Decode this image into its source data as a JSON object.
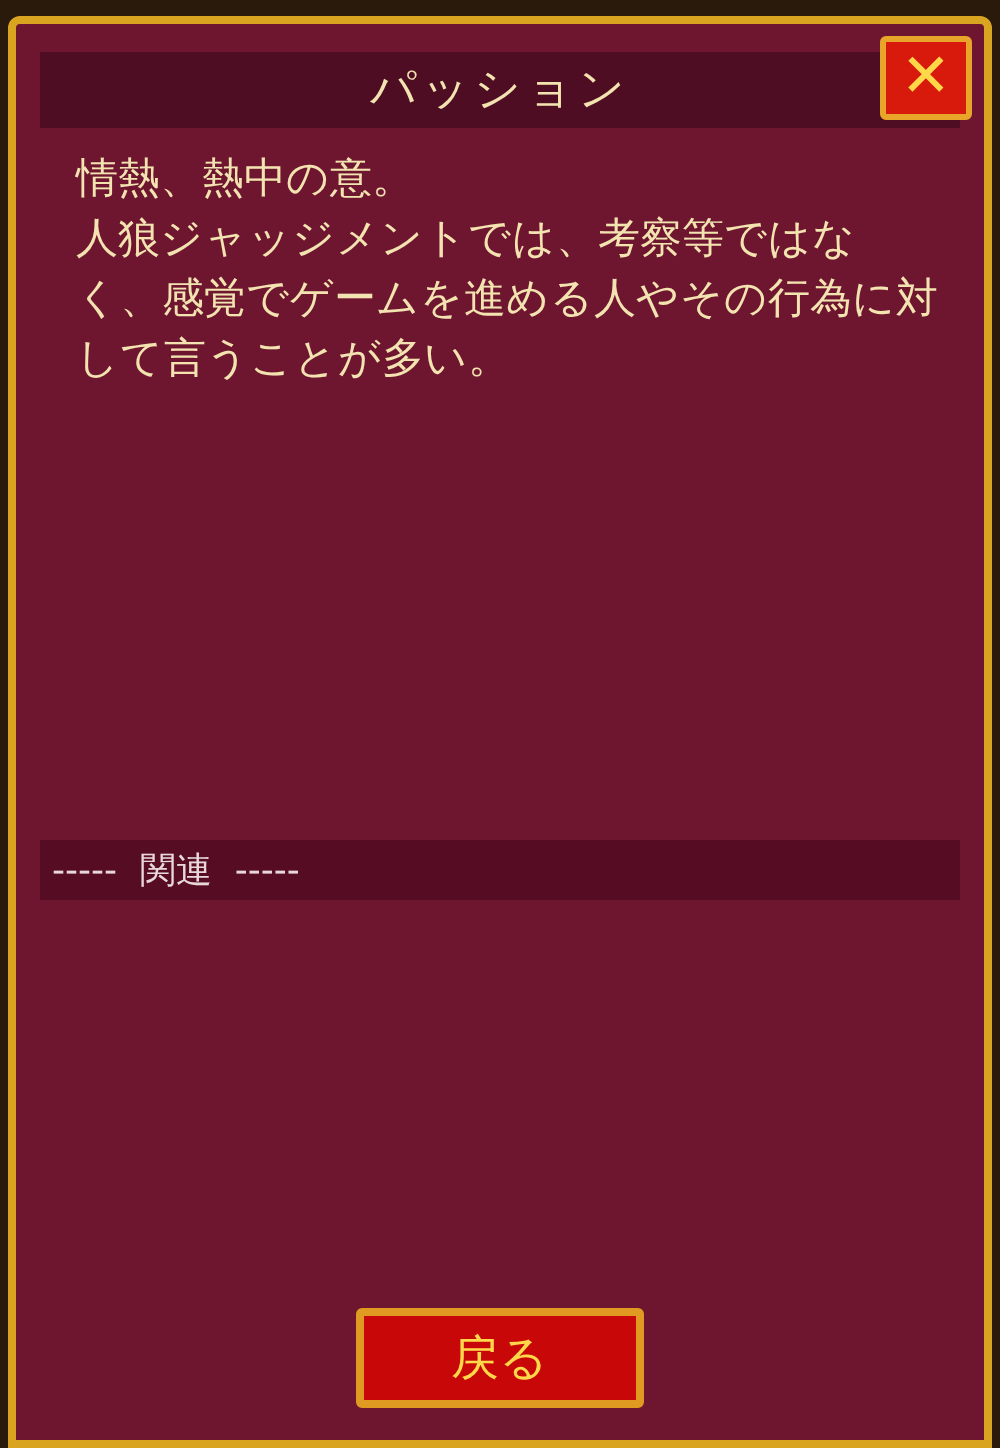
{
  "dialog": {
    "title": "パッション",
    "close_label": "✕",
    "paragraphs": [
      "情熱、熱中の意。",
      "人狼ジャッジメントでは、考察等ではなく、感覚でゲームを進める人やその行為に対して言うことが多い。"
    ],
    "related_header": "-----  関連  -----",
    "back_button": "戻る"
  }
}
